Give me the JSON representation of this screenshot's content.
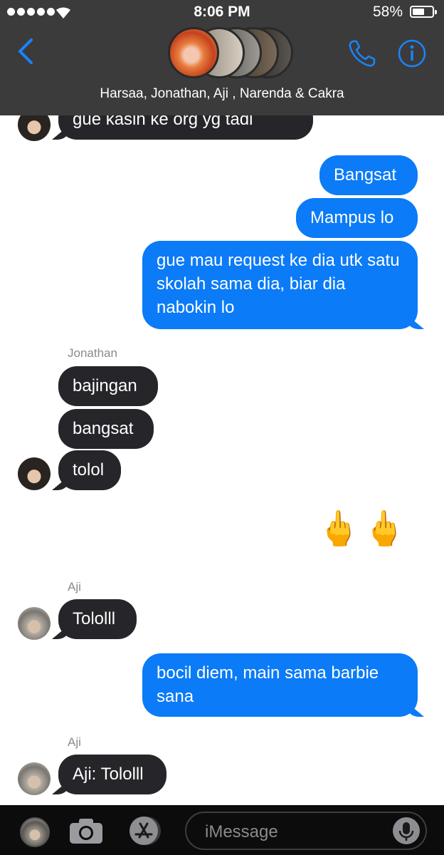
{
  "status_bar": {
    "time": "8:06 PM",
    "battery": "58%"
  },
  "header": {
    "group_names": "Harsaa, Jonathan, Aji , Narenda & Cakra",
    "back_icon": "chevron-left-icon",
    "call_icon": "phone-icon",
    "info_icon": "info-icon"
  },
  "messages": [
    {
      "direction": "in",
      "sender": "",
      "text": "gue kasih ke org yg tadi"
    },
    {
      "direction": "out",
      "text": "Bangsat"
    },
    {
      "direction": "out",
      "text": "Mampus lo"
    },
    {
      "direction": "out",
      "text": "gue mau request ke dia utk satu skolah sama dia, biar dia nabokin lo"
    },
    {
      "direction": "in",
      "sender": "Jonathan",
      "text": "bajingan"
    },
    {
      "direction": "in",
      "sender": "Jonathan",
      "text": "bangsat"
    },
    {
      "direction": "in",
      "sender": "Jonathan",
      "text": "tolol"
    },
    {
      "direction": "out",
      "text": "🖕🖕"
    },
    {
      "direction": "in",
      "sender": "Aji",
      "text": "Tololll"
    },
    {
      "direction": "out",
      "text": "bocil diem, main sama barbie sana"
    },
    {
      "direction": "in",
      "sender": "Aji",
      "text": "Aji: Tololll"
    }
  ],
  "input_bar": {
    "placeholder": "iMessage",
    "camera_icon": "camera-icon",
    "apps_icon": "app-store-icon",
    "mic_icon": "microphone-icon"
  },
  "colors": {
    "outgoing_bubble": "#0b7bf7",
    "incoming_bubble": "#26252a",
    "accent": "#1a84ff",
    "header_bg": "#3b3b3b"
  }
}
